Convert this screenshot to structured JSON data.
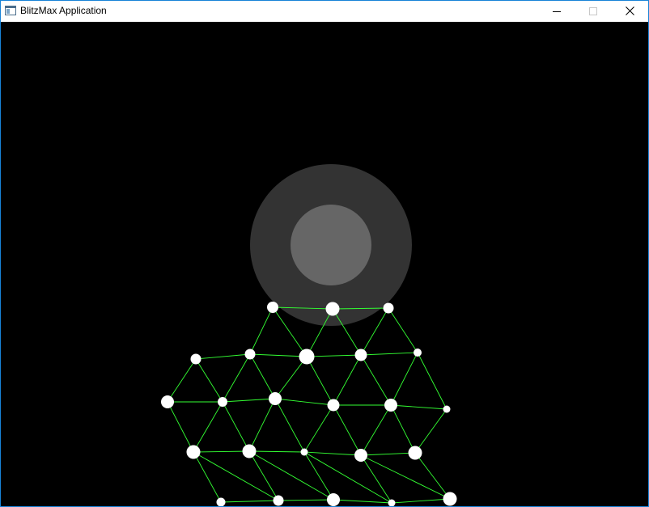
{
  "window": {
    "title": "BlitzMax Application"
  },
  "icons": {
    "app": "app-window-icon",
    "minimize": "minimize-icon",
    "maximize": "maximize-icon",
    "close": "close-icon"
  },
  "colors": {
    "canvas": "#000000",
    "outer_circle": "#333333",
    "inner_circle": "#666666",
    "mesh_line": "#33ff33",
    "node": "#ffffff",
    "window_border": "#1883d7"
  }
}
